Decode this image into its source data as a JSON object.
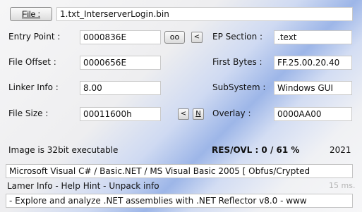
{
  "file_button": "File :",
  "file_name": "1.txt_InterserverLogin.bin",
  "labels": {
    "entry_point": "Entry Point :",
    "file_offset": "File Offset :",
    "linker_info": "Linker Info :",
    "file_size": "File Size :",
    "ep_section": "EP Section :",
    "first_bytes": "First Bytes :",
    "subsystem": "SubSystem :",
    "overlay": "Overlay :"
  },
  "values": {
    "entry_point": "0000836E",
    "file_offset": "0000656E",
    "linker_info": "8.00",
    "file_size": "00011600h",
    "ep_section": ".text",
    "first_bytes": "FF.25.00.20.40",
    "subsystem": "Windows GUI",
    "overlay": "0000AA00"
  },
  "buttons": {
    "oo": "oo",
    "ep_arrow": "<",
    "size_arrow": "<",
    "size_n": "N"
  },
  "status": {
    "image_info": "Image is 32bit executable",
    "res_ovl": "RES/OVL : 0 / 61 %",
    "year": "2021"
  },
  "detection": "Microsoft Visual C# / Basic.NET / MS Visual Basic 2005 [ Obfus/Crypted",
  "lamer_info": "Lamer Info - Help Hint - Unpack info",
  "timing": "15 ms.",
  "hint": "- Explore and analyze .NET assemblies with .NET Reflector v8.0 - www"
}
